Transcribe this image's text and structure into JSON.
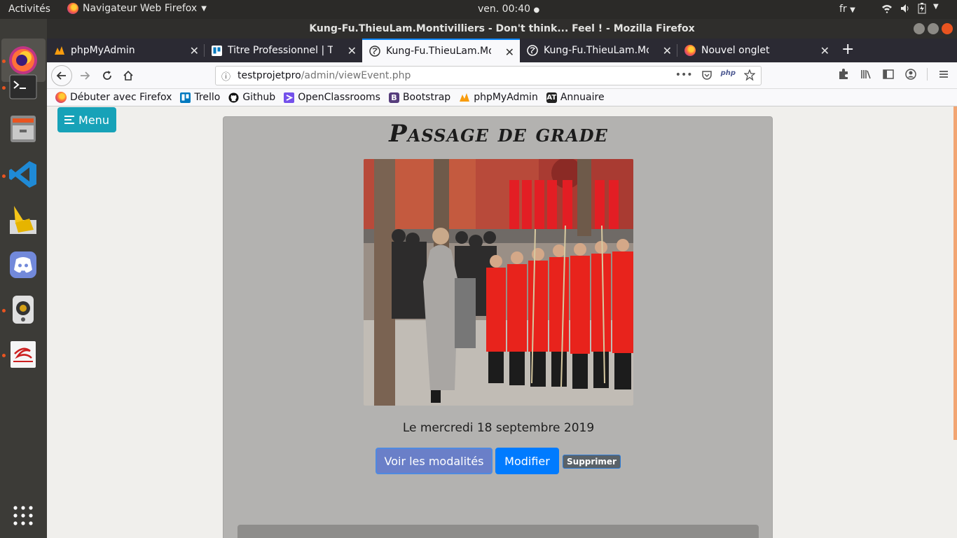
{
  "topbar": {
    "activities": "Activités",
    "app_name": "Navigateur Web Firefox",
    "clock": "ven. 00:40",
    "lang": "fr"
  },
  "window": {
    "title": "Kung-Fu.ThieuLam.Montivilliers - Don't think... Feel ! - Mozilla Firefox"
  },
  "tabs": [
    {
      "label": "phpMyAdmin"
    },
    {
      "label": "Titre Professionnel | Trel"
    },
    {
      "label": "Kung-Fu.ThieuLam.Monti"
    },
    {
      "label": "Kung-Fu.ThieuLam.Monti"
    },
    {
      "label": "Nouvel onglet"
    }
  ],
  "url": {
    "host": "testprojetpro",
    "path": "/admin/viewEvent.php"
  },
  "bookmarks": [
    {
      "label": "Débuter avec Firefox"
    },
    {
      "label": "Trello"
    },
    {
      "label": "Github"
    },
    {
      "label": "OpenClassrooms"
    },
    {
      "label": "Bootstrap"
    },
    {
      "label": "phpMyAdmin"
    },
    {
      "label": "Annuaire"
    }
  ],
  "page": {
    "menu_label": "Menu",
    "event_title": "Passage de grade",
    "date": "Le mercredi 18 septembre 2019",
    "btn_voir": "Voir les modalités",
    "btn_modifier": "Modifier",
    "btn_supprimer": "Supprimer"
  }
}
